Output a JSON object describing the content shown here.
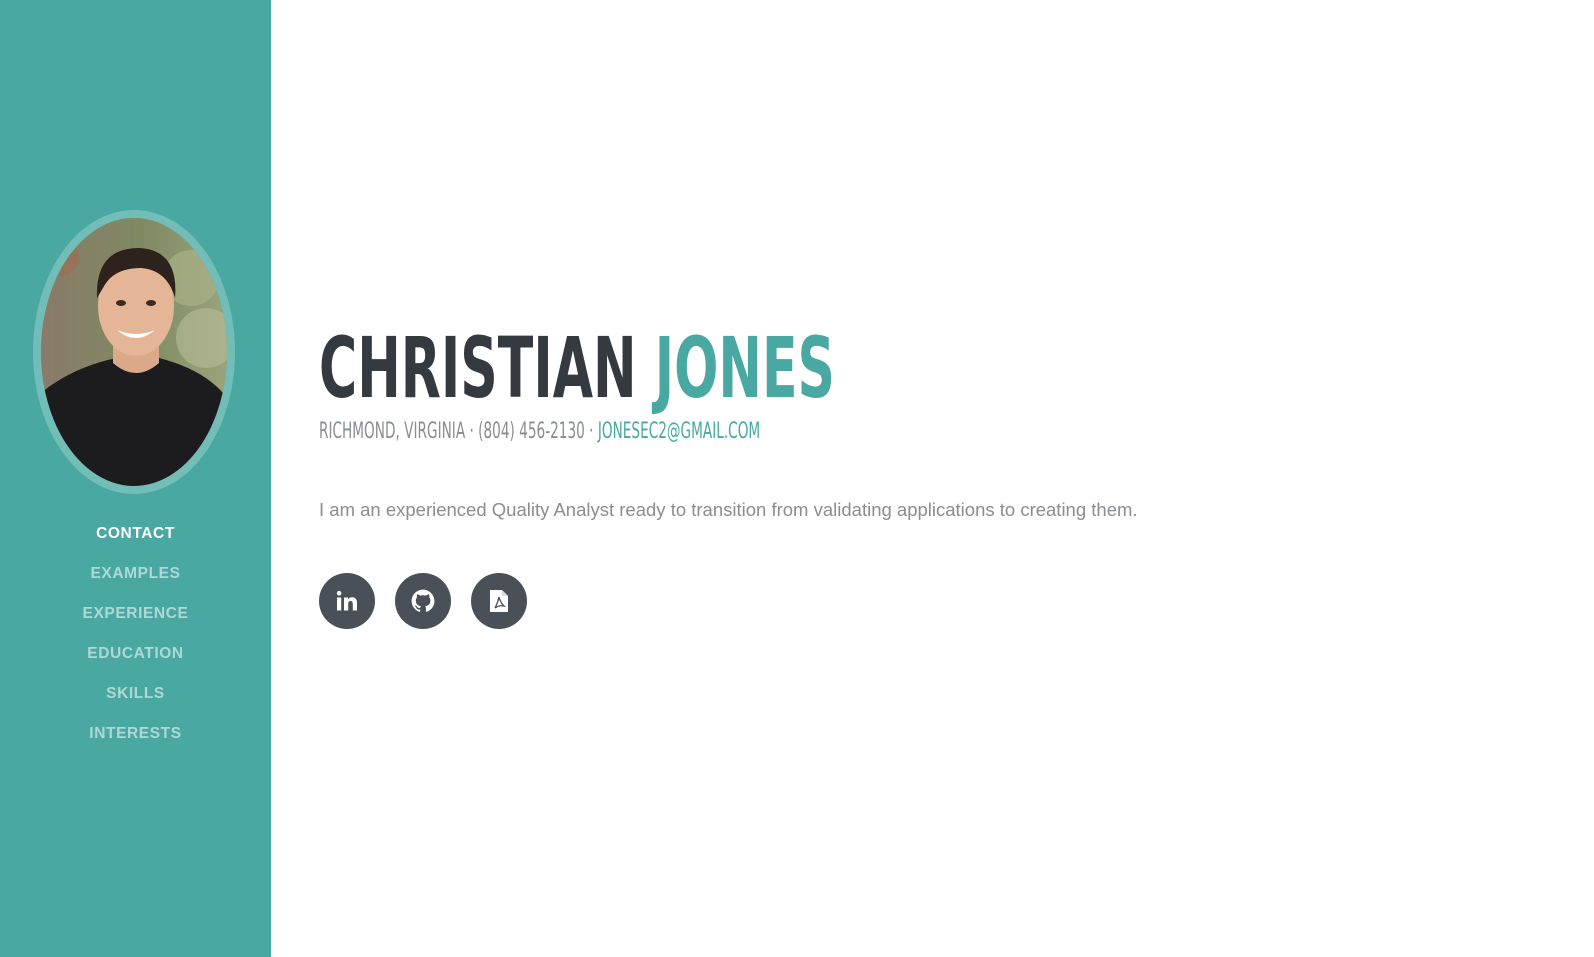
{
  "profile": {
    "photo_alt": "Christian Jones"
  },
  "nav": {
    "items": [
      {
        "label": "CONTACT",
        "active": true
      },
      {
        "label": "EXAMPLES",
        "active": false
      },
      {
        "label": "EXPERIENCE",
        "active": false
      },
      {
        "label": "EDUCATION",
        "active": false
      },
      {
        "label": "SKILLS",
        "active": false
      },
      {
        "label": "INTERESTS",
        "active": false
      }
    ]
  },
  "header": {
    "first_name": "CHRISTIAN",
    "last_name": "JONES",
    "location_phone": "RICHMOND, VIRGINIA · (804) 456-2130 · ",
    "email": "JONESEC2@GMAIL.COM"
  },
  "intro": {
    "text": "I am an experienced Quality Analyst ready to transition from validating applications to creating them."
  },
  "social": {
    "icons": [
      "linkedin-icon",
      "github-icon",
      "pdf-resume-icon"
    ]
  },
  "colors": {
    "primary": "#4aa8a3",
    "dark": "#343a40",
    "muted": "#868e96",
    "icon_bg": "#495057"
  }
}
